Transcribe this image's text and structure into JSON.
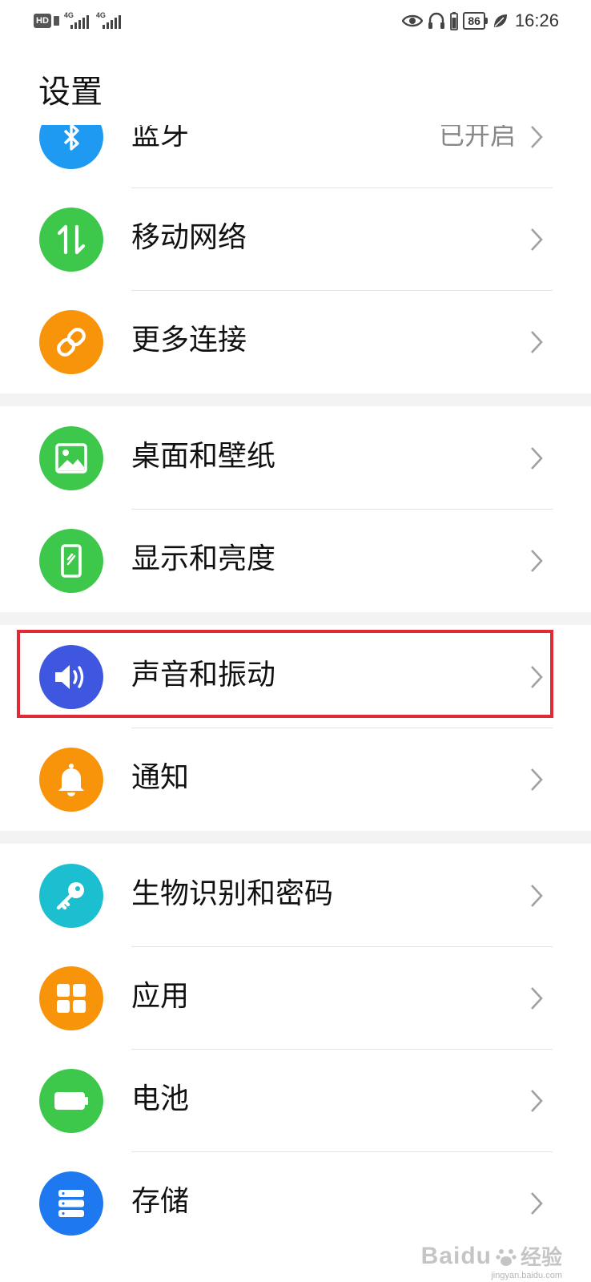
{
  "status_bar": {
    "hd": "HD",
    "signal1_label": "4G",
    "signal2_label": "4G",
    "battery_level": "86",
    "time": "16:26"
  },
  "page": {
    "title": "设置"
  },
  "settings": [
    {
      "label": "蓝牙",
      "value": "已开启",
      "icon": "bluetooth-icon",
      "color": "#1e9af2"
    },
    {
      "label": "移动网络",
      "icon": "mobile-data-icon",
      "color": "#3dc84b"
    },
    {
      "label": "更多连接",
      "icon": "link-icon",
      "color": "#f7940a"
    },
    {
      "label": "桌面和壁纸",
      "icon": "image-icon",
      "color": "#3dc84b"
    },
    {
      "label": "显示和亮度",
      "icon": "phone-display-icon",
      "color": "#3dc84b"
    },
    {
      "label": "声音和振动",
      "icon": "speaker-icon",
      "color": "#3f57e0"
    },
    {
      "label": "通知",
      "icon": "bell-icon",
      "color": "#f7940a"
    },
    {
      "label": "生物识别和密码",
      "icon": "key-icon",
      "color": "#1cbfd0"
    },
    {
      "label": "应用",
      "icon": "apps-grid-icon",
      "color": "#f7940a"
    },
    {
      "label": "电池",
      "icon": "battery-icon",
      "color": "#3dc84b"
    },
    {
      "label": "存储",
      "icon": "storage-icon",
      "color": "#1e78f0"
    }
  ],
  "highlight_color": "#e02a35",
  "watermark": {
    "brand": "Baidu",
    "sub": "经验",
    "url": "jingyan.baidu.com"
  }
}
